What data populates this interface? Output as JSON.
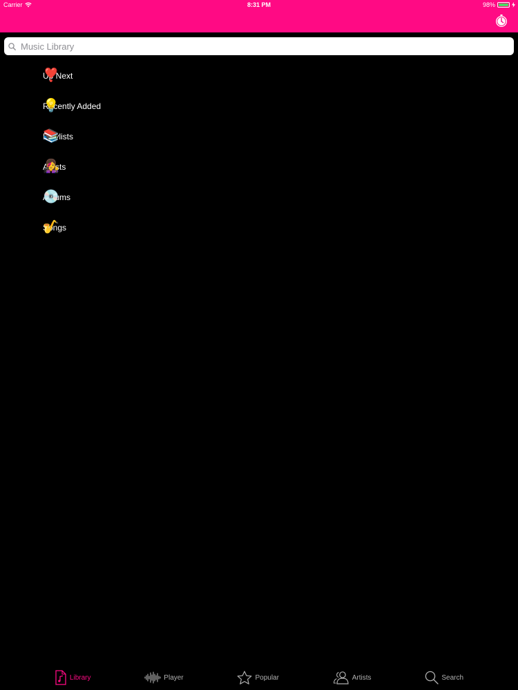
{
  "status_bar": {
    "carrier": "Carrier",
    "time": "8:31 PM",
    "battery_percent": "98%",
    "battery_level": 0.98
  },
  "nav_bar": {
    "background_color": "#ff0a84",
    "right_icon": "timer-icon"
  },
  "search": {
    "placeholder": "Music Library",
    "value": ""
  },
  "library": {
    "items": [
      {
        "emoji": "❣️",
        "label": "Up Next"
      },
      {
        "emoji": "💡",
        "label": "Recently Added"
      },
      {
        "emoji": "📚",
        "label": "Playlists"
      },
      {
        "emoji": "👩‍🎤",
        "label": "Artists"
      },
      {
        "emoji": "💿",
        "label": "Albums"
      },
      {
        "emoji": "🎷",
        "label": "Songs"
      }
    ]
  },
  "tab_bar": {
    "accent_color": "#ff0a84",
    "tabs": [
      {
        "label": "Library",
        "icon": "music-note-icon",
        "active": true
      },
      {
        "label": "Player",
        "icon": "waveform-icon",
        "active": false
      },
      {
        "label": "Popular",
        "icon": "star-icon",
        "active": false
      },
      {
        "label": "Artists",
        "icon": "people-icon",
        "active": false
      },
      {
        "label": "Search",
        "icon": "search-icon",
        "active": false
      }
    ]
  }
}
